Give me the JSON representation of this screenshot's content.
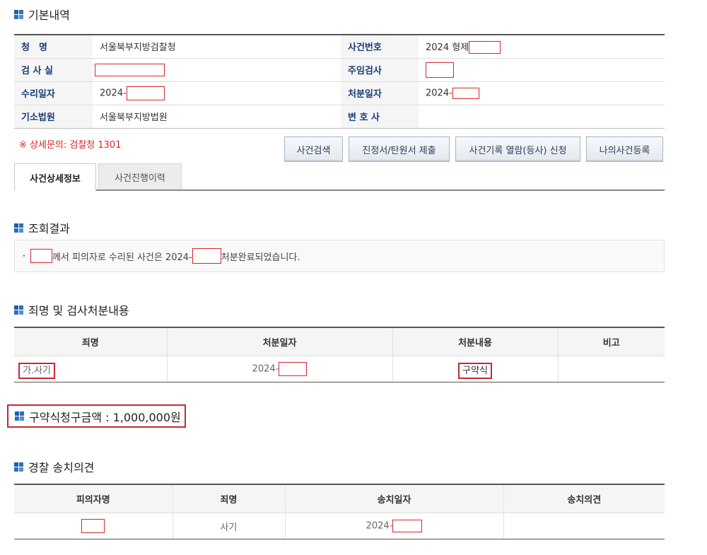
{
  "basic": {
    "title": "기본내역",
    "rows": [
      {
        "l1": "청　명",
        "v1": "서울북부지방검찰청",
        "l2": "사건번호",
        "v2": "2024 형제"
      },
      {
        "l1": "검 사 실",
        "v1": "",
        "l2": "주임검사",
        "v2": ""
      },
      {
        "l1": "수리일자",
        "v1": "2024-",
        "l2": "처분일자",
        "v2": "2024-"
      },
      {
        "l1": "기소법원",
        "v1": "서울북부지방법원",
        "l2": "변 호 사",
        "v2": ""
      }
    ],
    "notice": "※ 상세문의: 검찰청 1301"
  },
  "buttons": {
    "search": "사건검색",
    "petition": "진정서/탄원서 제출",
    "records": "사건기록 열람(등사) 신청",
    "register": "나의사건등록"
  },
  "tabs": {
    "detail": "사건상세정보",
    "history": "사건진행이력"
  },
  "result": {
    "title": "조회결과",
    "text_before": "께서 피의자로 수리된 사건은 2024-",
    "text_after": "처분완료되었습니다."
  },
  "disposition": {
    "title": "죄명 및 검사처분내용",
    "headers": [
      "죄명",
      "처분일자",
      "처분내용",
      "비고"
    ],
    "charge": "가.사기",
    "date": "2024-",
    "content": "구약식",
    "note": ""
  },
  "amount": {
    "text": "구약식청구금액 : 1,000,000원"
  },
  "police": {
    "title": "경찰 송치의견",
    "headers": [
      "피의자명",
      "죄명",
      "송치일자",
      "송치의견"
    ],
    "name": "",
    "charge": "사기",
    "date": "2024-",
    "opinion": ""
  },
  "colors": {
    "accent": "#2e6fb6",
    "label": "#1c3d77",
    "redact": "#d9262b"
  }
}
